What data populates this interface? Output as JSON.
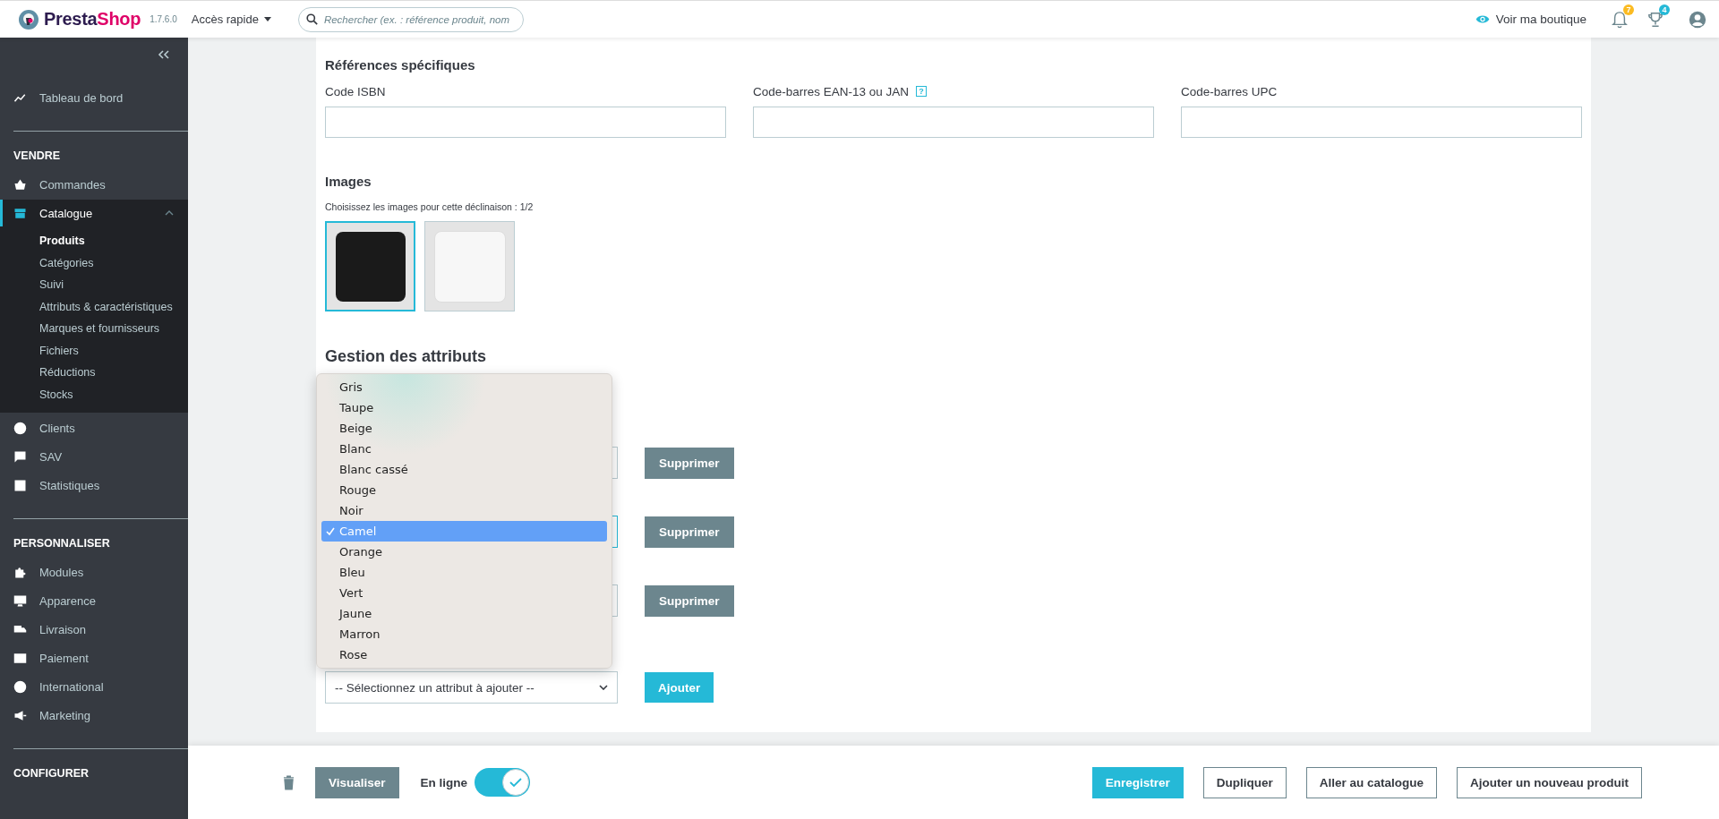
{
  "topbar": {
    "brand_parts": [
      "Presta",
      "Shop"
    ],
    "version": "1.7.6.0",
    "quick_access": "Accès rapide",
    "search": {
      "placeholder": "Rechercher (ex. : référence produit, nom"
    },
    "view_shop": "Voir ma boutique",
    "notifications": "7",
    "achievements": "4"
  },
  "sidebar": {
    "items": [
      {
        "kind": "link",
        "label": "Tableau de bord",
        "selected": false
      },
      {
        "kind": "divider"
      },
      {
        "kind": "section",
        "label": "VENDRE"
      },
      {
        "kind": "link",
        "label": "Commandes",
        "selected": false
      },
      {
        "kind": "link",
        "label": "Catalogue",
        "selected": true,
        "expanded": true,
        "children": [
          {
            "label": "Produits",
            "selected": true
          },
          {
            "label": "Catégories",
            "selected": false
          },
          {
            "label": "Suivi",
            "selected": false
          },
          {
            "label": "Attributs & caractéristiques",
            "selected": false
          },
          {
            "label": "Marques et fournisseurs",
            "selected": false
          },
          {
            "label": "Fichiers",
            "selected": false
          },
          {
            "label": "Réductions",
            "selected": false
          },
          {
            "label": "Stocks",
            "selected": false
          }
        ]
      },
      {
        "kind": "link",
        "label": "Clients",
        "selected": false
      },
      {
        "kind": "link",
        "label": "SAV",
        "selected": false
      },
      {
        "kind": "link",
        "label": "Statistiques",
        "selected": false
      },
      {
        "kind": "divider"
      },
      {
        "kind": "section",
        "label": "PERSONNALISER"
      },
      {
        "kind": "link",
        "label": "Modules",
        "selected": false
      },
      {
        "kind": "link",
        "label": "Apparence",
        "selected": false
      },
      {
        "kind": "link",
        "label": "Livraison",
        "selected": false
      },
      {
        "kind": "link",
        "label": "Paiement",
        "selected": false
      },
      {
        "kind": "link",
        "label": "International",
        "selected": false
      },
      {
        "kind": "link",
        "label": "Marketing",
        "selected": false
      },
      {
        "kind": "divider"
      },
      {
        "kind": "section",
        "label": "CONFIGURER"
      }
    ]
  },
  "references": {
    "title": "Références spécifiques",
    "fields": [
      {
        "label": "Code ISBN"
      },
      {
        "label": "Code-barres EAN-13 ou JAN",
        "help": "?"
      },
      {
        "label": "Code-barres UPC"
      }
    ]
  },
  "images": {
    "title": "Images",
    "caption": "Choisissez les images pour cette déclinaison : 1/2",
    "items": [
      {
        "kind": "dark",
        "selected": true
      },
      {
        "kind": "light",
        "selected": false
      }
    ]
  },
  "attributes": {
    "title": "Gestion des attributs",
    "rows": [
      {
        "button": "Supprimer",
        "focused": false
      },
      {
        "button": "Supprimer",
        "focused": true
      },
      {
        "button": "Supprimer",
        "focused": false
      }
    ],
    "add_select": {
      "value": "-- Sélectionnez un attribut à ajouter --"
    },
    "add_button": "Ajouter",
    "dropdown": [
      {
        "label": "Gris",
        "selected": false
      },
      {
        "label": "Taupe",
        "selected": false
      },
      {
        "label": "Beige",
        "selected": false
      },
      {
        "label": "Blanc",
        "selected": false
      },
      {
        "label": "Blanc cassé",
        "selected": false
      },
      {
        "label": "Rouge",
        "selected": false
      },
      {
        "label": "Noir",
        "selected": false
      },
      {
        "label": "Camel",
        "selected": true
      },
      {
        "label": "Orange",
        "selected": false
      },
      {
        "label": "Bleu",
        "selected": false
      },
      {
        "label": "Vert",
        "selected": false
      },
      {
        "label": "Jaune",
        "selected": false
      },
      {
        "label": "Marron",
        "selected": false
      },
      {
        "label": "Rose",
        "selected": false
      }
    ]
  },
  "footer": {
    "preview": "Visualiser",
    "online_label": "En ligne",
    "online": true,
    "buttons": [
      {
        "label": "Enregistrer",
        "kind": "primary"
      },
      {
        "label": "Dupliquer",
        "kind": "outline"
      },
      {
        "label": "Aller au catalogue",
        "kind": "outline"
      },
      {
        "label": "Ajouter un nouveau produit",
        "kind": "outline"
      }
    ]
  }
}
